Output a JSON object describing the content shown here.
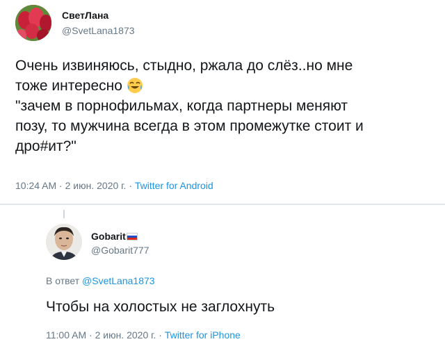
{
  "tweet": {
    "author_name": "СветЛана",
    "author_handle": "@SvetLana1873",
    "text_line1": "Очень извиняюсь, стыдно, ржала до слёз..но мне",
    "text_line2_prefix": "тоже интересно ",
    "text_rest": "\"зачем в порнофильмах, когда партнеры меняют\nпозу, то мужчина всегда в этом промежутке стоит и\nдро#ит?\"",
    "emoji": "face-with-tears-of-joy-emoji",
    "time": "10:24 AM",
    "date": "2 июн. 2020 г.",
    "source": "Twitter for Android"
  },
  "reply": {
    "author_name": "Gobarit",
    "flag": "russia-flag-icon",
    "author_handle": "@Gobarit777",
    "reply_to_label": "В ответ",
    "reply_to_handle": "@SvetLana1873",
    "text": "Чтобы на холостых не заглохнуть",
    "time": "11:00 AM",
    "date": "2 июн. 2020 г.",
    "source": "Twitter for iPhone"
  },
  "meta_separator": " · ",
  "colors": {
    "text": "#14171a",
    "secondary": "#657786",
    "link": "#1b95e0",
    "divider": "#e1e8ed"
  }
}
